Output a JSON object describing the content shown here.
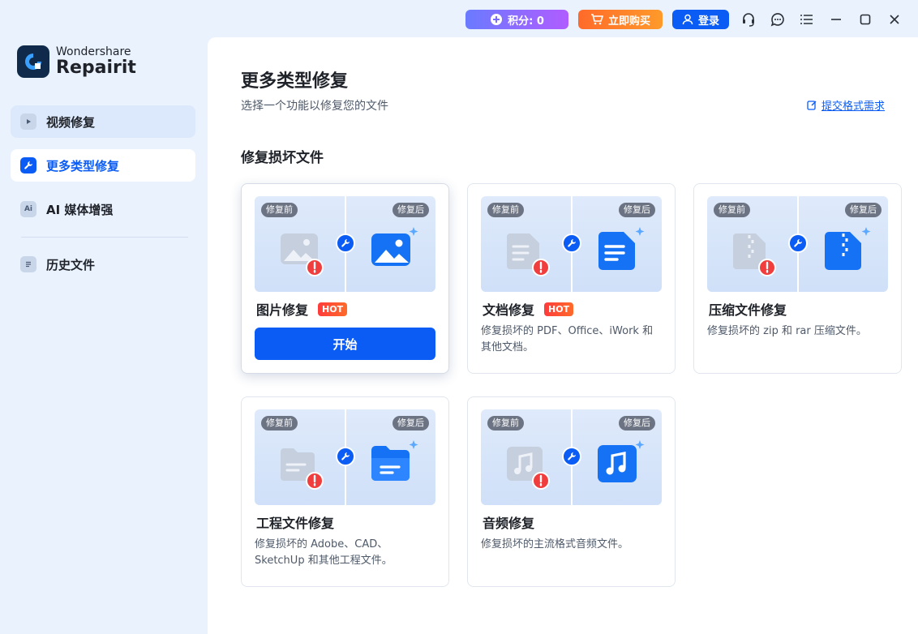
{
  "titlebar": {
    "points_label": "积分: 0",
    "buy_label": "立即购买",
    "login_label": "登录",
    "icons": [
      "headset-icon",
      "chat-icon",
      "menu-icon",
      "minimize-icon",
      "maximize-icon",
      "close-icon"
    ]
  },
  "brand": {
    "company": "Wondershare",
    "product": "Repairit"
  },
  "sidebar": {
    "items": [
      {
        "label": "视频修复",
        "icon": "video-icon"
      },
      {
        "label": "更多类型修复",
        "icon": "wrench-icon"
      },
      {
        "label": "AI 媒体增强",
        "icon": "ai-icon",
        "icon_text": "Ai"
      },
      {
        "label": "历史文件",
        "icon": "history-icon"
      }
    ]
  },
  "main": {
    "title": "更多类型修复",
    "subtitle": "选择一个功能以修复您的文件",
    "submit_link": "提交格式需求",
    "section_title": "修复损坏文件",
    "badge_before": "修复前",
    "badge_after": "修复后",
    "hot_label": "HOT",
    "start_label": "开始",
    "cards": [
      {
        "title": "图片修复",
        "hot": true,
        "desc": ""
      },
      {
        "title": "文档修复",
        "hot": true,
        "desc": "修复损坏的 PDF、Office、iWork 和其他文档。"
      },
      {
        "title": "压缩文件修复",
        "hot": false,
        "desc": "修复损坏的 zip 和 rar 压缩文件。"
      },
      {
        "title": "工程文件修复",
        "hot": false,
        "desc": "修复损坏的 Adobe、CAD、SketchUp 和其他工程文件。"
      },
      {
        "title": "音频修复",
        "hot": false,
        "desc": "修复损坏的主流格式音频文件。"
      }
    ]
  },
  "colors": {
    "accent": "#0a5cf5",
    "sidebar_bg": "#eaf2fe",
    "hot": "#ff3b3b",
    "error": "#f03e3e"
  }
}
